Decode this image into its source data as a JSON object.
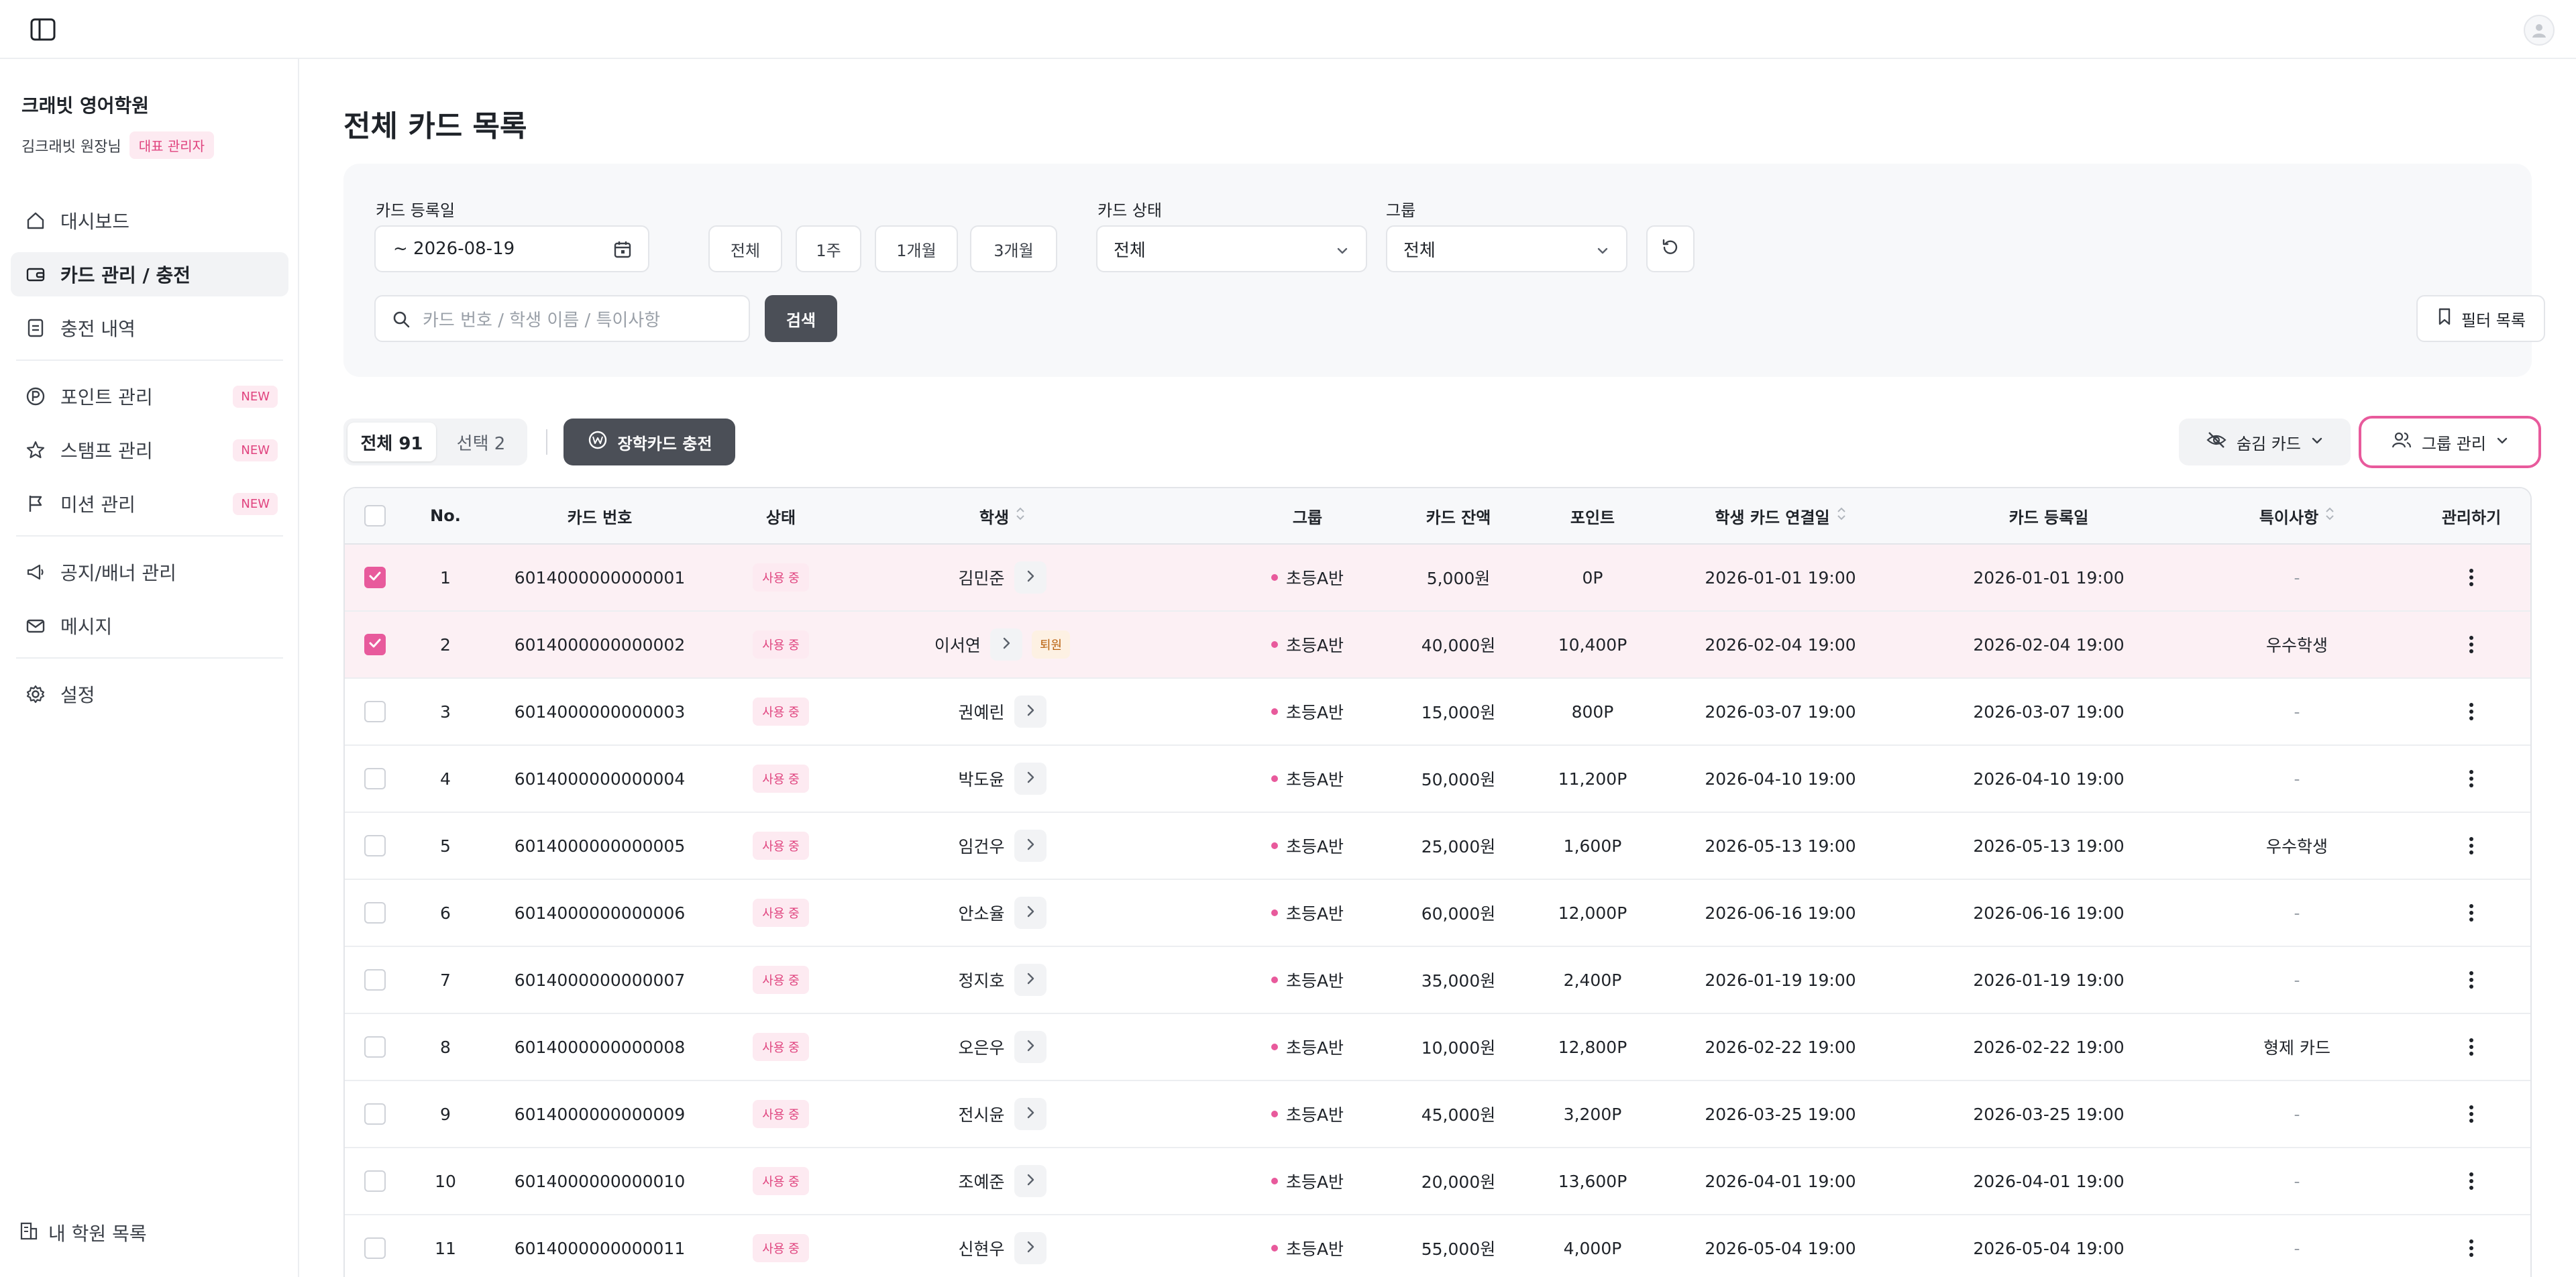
{
  "sidebar": {
    "org_name": "크래빗 영어학원",
    "user_name": "김크래빗 원장님",
    "role_badge": "대표 관리자",
    "items": [
      {
        "label": "대시보드",
        "icon": "home-icon"
      },
      {
        "label": "카드 관리 / 충전",
        "icon": "card-icon",
        "active": true
      },
      {
        "label": "충전 내역",
        "icon": "receipt-icon"
      },
      {
        "label": "포인트 관리",
        "icon": "point-icon",
        "badge": "NEW"
      },
      {
        "label": "스탬프 관리",
        "icon": "star-icon",
        "badge": "NEW"
      },
      {
        "label": "미션 관리",
        "icon": "flag-icon",
        "badge": "NEW"
      },
      {
        "label": "공지/배너 관리",
        "icon": "megaphone-icon"
      },
      {
        "label": "메시지",
        "icon": "mail-icon"
      },
      {
        "label": "설정",
        "icon": "gear-icon"
      }
    ],
    "bottom_label": "내 학원 목록"
  },
  "page": {
    "title": "전체 카드 목록"
  },
  "filters": {
    "date_label": "카드 등록일",
    "date_value": "~ 2026-08-19",
    "range_chips": [
      "전체",
      "1주",
      "1개월",
      "3개월"
    ],
    "status_label": "카드 상태",
    "status_value": "전체",
    "group_label": "그룹",
    "group_value": "전체",
    "search_placeholder": "카드 번호 / 학생 이름 / 특이사항",
    "search_button": "검색",
    "filter_list_button": "필터 목록"
  },
  "toolbar": {
    "tab_all": "전체 91",
    "tab_selected": "선택 2",
    "charge_button": "장학카드 충전",
    "hidden_cards": "숨김 카드",
    "group_manage": "그룹 관리"
  },
  "colors": {
    "accent": "#e85a9c",
    "selected_row": "#fcf0f4",
    "dark_button": "#4b4f57"
  },
  "table": {
    "headers": {
      "no": "No.",
      "card_no": "카드 번호",
      "status": "상태",
      "student": "학생",
      "group": "그룹",
      "balance": "카드 잔액",
      "points": "포인트",
      "linked": "학생 카드 연결일",
      "registered": "카드 등록일",
      "note": "특이사항",
      "manage": "관리하기"
    },
    "rows": [
      {
        "no": "1",
        "card": "6014000000000001",
        "status": "사용 중",
        "student": "김민준",
        "badge": "",
        "group": "초등A반",
        "balance": "5,000원",
        "points": "0P",
        "linked": "2026-01-01 19:00",
        "registered": "2026-01-01 19:00",
        "note": "-",
        "selected": true
      },
      {
        "no": "2",
        "card": "6014000000000002",
        "status": "사용 중",
        "student": "이서연",
        "badge": "퇴원",
        "group": "초등A반",
        "balance": "40,000원",
        "points": "10,400P",
        "linked": "2026-02-04 19:00",
        "registered": "2026-02-04 19:00",
        "note": "우수학생",
        "selected": true
      },
      {
        "no": "3",
        "card": "6014000000000003",
        "status": "사용 중",
        "student": "권예린",
        "badge": "",
        "group": "초등A반",
        "balance": "15,000원",
        "points": "800P",
        "linked": "2026-03-07 19:00",
        "registered": "2026-03-07 19:00",
        "note": "-",
        "selected": false
      },
      {
        "no": "4",
        "card": "6014000000000004",
        "status": "사용 중",
        "student": "박도윤",
        "badge": "",
        "group": "초등A반",
        "balance": "50,000원",
        "points": "11,200P",
        "linked": "2026-04-10 19:00",
        "registered": "2026-04-10 19:00",
        "note": "-",
        "selected": false
      },
      {
        "no": "5",
        "card": "6014000000000005",
        "status": "사용 중",
        "student": "임건우",
        "badge": "",
        "group": "초등A반",
        "balance": "25,000원",
        "points": "1,600P",
        "linked": "2026-05-13 19:00",
        "registered": "2026-05-13 19:00",
        "note": "우수학생",
        "selected": false
      },
      {
        "no": "6",
        "card": "6014000000000006",
        "status": "사용 중",
        "student": "안소율",
        "badge": "",
        "group": "초등A반",
        "balance": "60,000원",
        "points": "12,000P",
        "linked": "2026-06-16 19:00",
        "registered": "2026-06-16 19:00",
        "note": "-",
        "selected": false
      },
      {
        "no": "7",
        "card": "6014000000000007",
        "status": "사용 중",
        "student": "정지호",
        "badge": "",
        "group": "초등A반",
        "balance": "35,000원",
        "points": "2,400P",
        "linked": "2026-01-19 19:00",
        "registered": "2026-01-19 19:00",
        "note": "-",
        "selected": false
      },
      {
        "no": "8",
        "card": "6014000000000008",
        "status": "사용 중",
        "student": "오은우",
        "badge": "",
        "group": "초등A반",
        "balance": "10,000원",
        "points": "12,800P",
        "linked": "2026-02-22 19:00",
        "registered": "2026-02-22 19:00",
        "note": "형제 카드",
        "selected": false
      },
      {
        "no": "9",
        "card": "6014000000000009",
        "status": "사용 중",
        "student": "전시윤",
        "badge": "",
        "group": "초등A반",
        "balance": "45,000원",
        "points": "3,200P",
        "linked": "2026-03-25 19:00",
        "registered": "2026-03-25 19:00",
        "note": "-",
        "selected": false
      },
      {
        "no": "10",
        "card": "6014000000000010",
        "status": "사용 중",
        "student": "조예준",
        "badge": "",
        "group": "초등A반",
        "balance": "20,000원",
        "points": "13,600P",
        "linked": "2026-04-01 19:00",
        "registered": "2026-04-01 19:00",
        "note": "-",
        "selected": false
      },
      {
        "no": "11",
        "card": "6014000000000011",
        "status": "사용 중",
        "student": "신현우",
        "badge": "",
        "group": "초등A반",
        "balance": "55,000원",
        "points": "4,000P",
        "linked": "2026-05-04 19:00",
        "registered": "2026-05-04 19:00",
        "note": "-",
        "selected": false
      }
    ]
  }
}
